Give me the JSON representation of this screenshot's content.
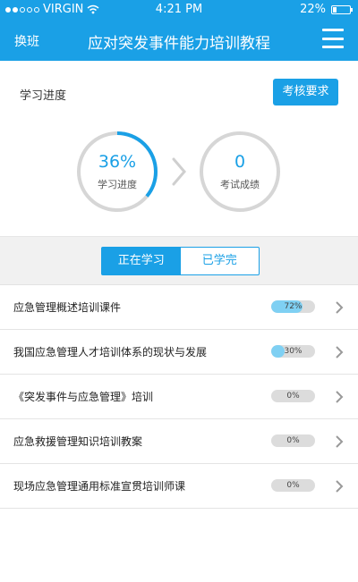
{
  "status_bar": {
    "carrier": "VIRGIN",
    "time": "4:21 PM",
    "battery": "22%",
    "battery_level": 0.22
  },
  "header": {
    "left_label": "换班",
    "title": "应对突发事件能力培训教程",
    "menu_icon": "hamburger-menu-icon"
  },
  "progress_section": {
    "label": "学习进度",
    "exam_button": "考核要求",
    "study_progress": {
      "value": "36%",
      "fraction": 0.36,
      "label": "学习进度"
    },
    "exam_score": {
      "value": "0",
      "fraction": 0.0,
      "label": "考试成绩"
    }
  },
  "tabs": [
    {
      "label": "正在学习",
      "active": true
    },
    {
      "label": "已学完",
      "active": false
    }
  ],
  "courses": [
    {
      "title": "应急管理概述培训课件",
      "progress": "72%",
      "fraction": 0.72
    },
    {
      "title": "我国应急管理人才培训体系的现状与发展",
      "progress": "30%",
      "fraction": 0.3
    },
    {
      "title": "《突发事件与应急管理》培训",
      "progress": "0%",
      "fraction": 0.0
    },
    {
      "title": "应急救援管理知识培训教案",
      "progress": "0%",
      "fraction": 0.0
    },
    {
      "title": "现场应急管理通用标准宣贯培训师课",
      "progress": "0%",
      "fraction": 0.0
    }
  ],
  "colors": {
    "accent": "#1aa0e6",
    "progress_fill": "#7fd0f3",
    "ring_track": "#d6d6d6"
  }
}
